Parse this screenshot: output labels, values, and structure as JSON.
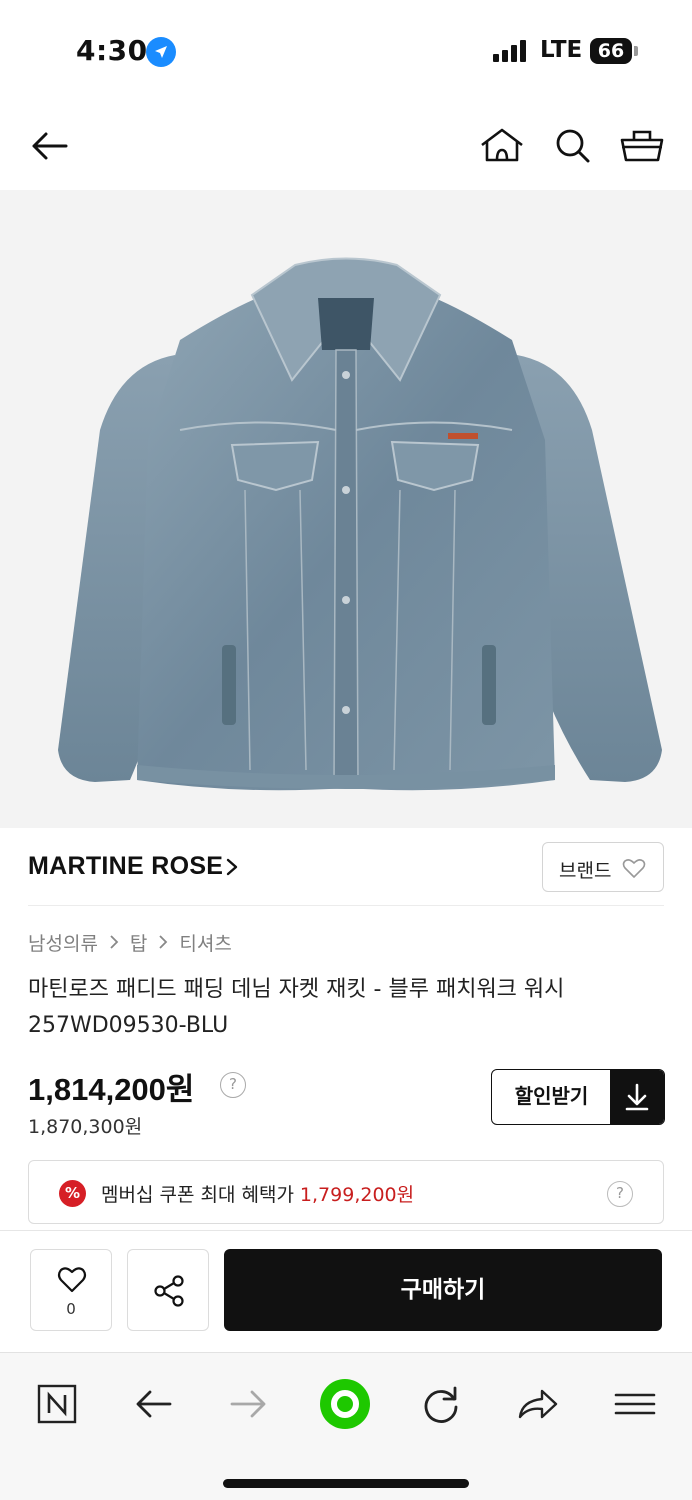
{
  "status_bar": {
    "time": "4:30",
    "network": "LTE",
    "battery": "66"
  },
  "top_nav": {
    "icons": [
      "back-arrow-icon",
      "home-icon",
      "search-icon",
      "cart-icon"
    ]
  },
  "product": {
    "image": "blue washed padded denim trucker jacket",
    "brand": "MARTINE ROSE",
    "brand_button_label": "브랜드",
    "breadcrumb": [
      "남성의류",
      "탑",
      "티셔츠"
    ],
    "title_line1": "마틴로즈 패디드 패딩 데님 자켓 재킷 - 블루 패치워크 워시",
    "title_line2": "257WD09530-BLU",
    "price": "1,814,200원",
    "original_price": "1,870,300원",
    "discount_button_label": "할인받기",
    "help_mark": "?"
  },
  "coupon": {
    "badge": "%",
    "label": "멤버십 쿠폰 최대 혜택가",
    "amount": "1,799,200원",
    "help_mark": "?"
  },
  "action_bar": {
    "like_count": "0",
    "buy_label": "구매하기"
  },
  "browser_bar": {
    "icons": [
      "naver-n-icon",
      "back-icon",
      "forward-icon",
      "green-dot-icon",
      "reload-icon",
      "share-icon",
      "menu-icon"
    ]
  },
  "colors": {
    "accent_red": "#c81e1e",
    "badge_red": "#d61f26",
    "primary_black": "#111111",
    "location_blue": "#1a8cff",
    "browser_green": "#1ec800"
  }
}
